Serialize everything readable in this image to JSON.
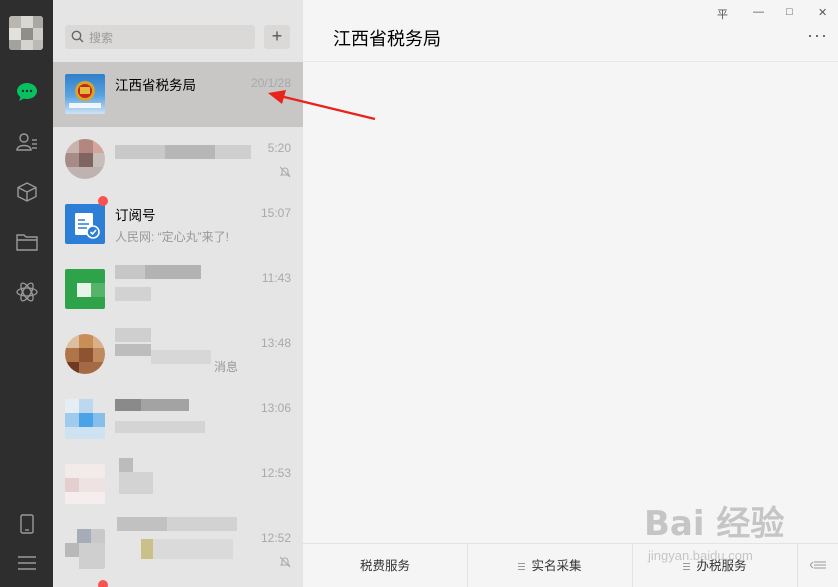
{
  "search": {
    "placeholder": "搜索"
  },
  "add_button": "+",
  "chats": [
    {
      "name": "江西省税务局",
      "time": "20/1/28",
      "preview": "",
      "active": true
    },
    {
      "name": "",
      "time": "5:20",
      "preview": "",
      "muted": true
    },
    {
      "name": "订阅号",
      "time": "15:07",
      "preview": "人民网: “定心丸”来了!",
      "unread_dot": true
    },
    {
      "name": "",
      "time": "11:43",
      "preview": ""
    },
    {
      "name": "",
      "time": "13:48",
      "preview": "消息"
    },
    {
      "name": "",
      "time": "13:06",
      "preview": ""
    },
    {
      "name": "",
      "time": "12:53",
      "preview": ""
    },
    {
      "name": "",
      "time": "12:52",
      "preview": "",
      "muted": true
    }
  ],
  "main": {
    "title": "江西省税务局",
    "more": "···",
    "window_controls": {
      "pin": "平",
      "minimize": "—",
      "maximize": "□",
      "close": "✕"
    },
    "menu": [
      {
        "label": "税费服务"
      },
      {
        "label": "实名采集"
      },
      {
        "label": "办税服务"
      }
    ]
  },
  "watermark": {
    "brand": "Bai 经验",
    "url": "jingyan.baidu.com"
  },
  "icons": [
    "search-icon",
    "chat-icon",
    "contacts-icon",
    "box-icon",
    "folder-icon",
    "mini-program-icon",
    "phone-icon",
    "menu-icon",
    "mute-icon"
  ],
  "colors": {
    "rail": "#2e2e2e",
    "list": "#e6e5e5",
    "active_item": "#c9c7c6",
    "accent_green": "#07c160",
    "arrow_red": "#e8231a",
    "unread_red": "#fa5151"
  }
}
